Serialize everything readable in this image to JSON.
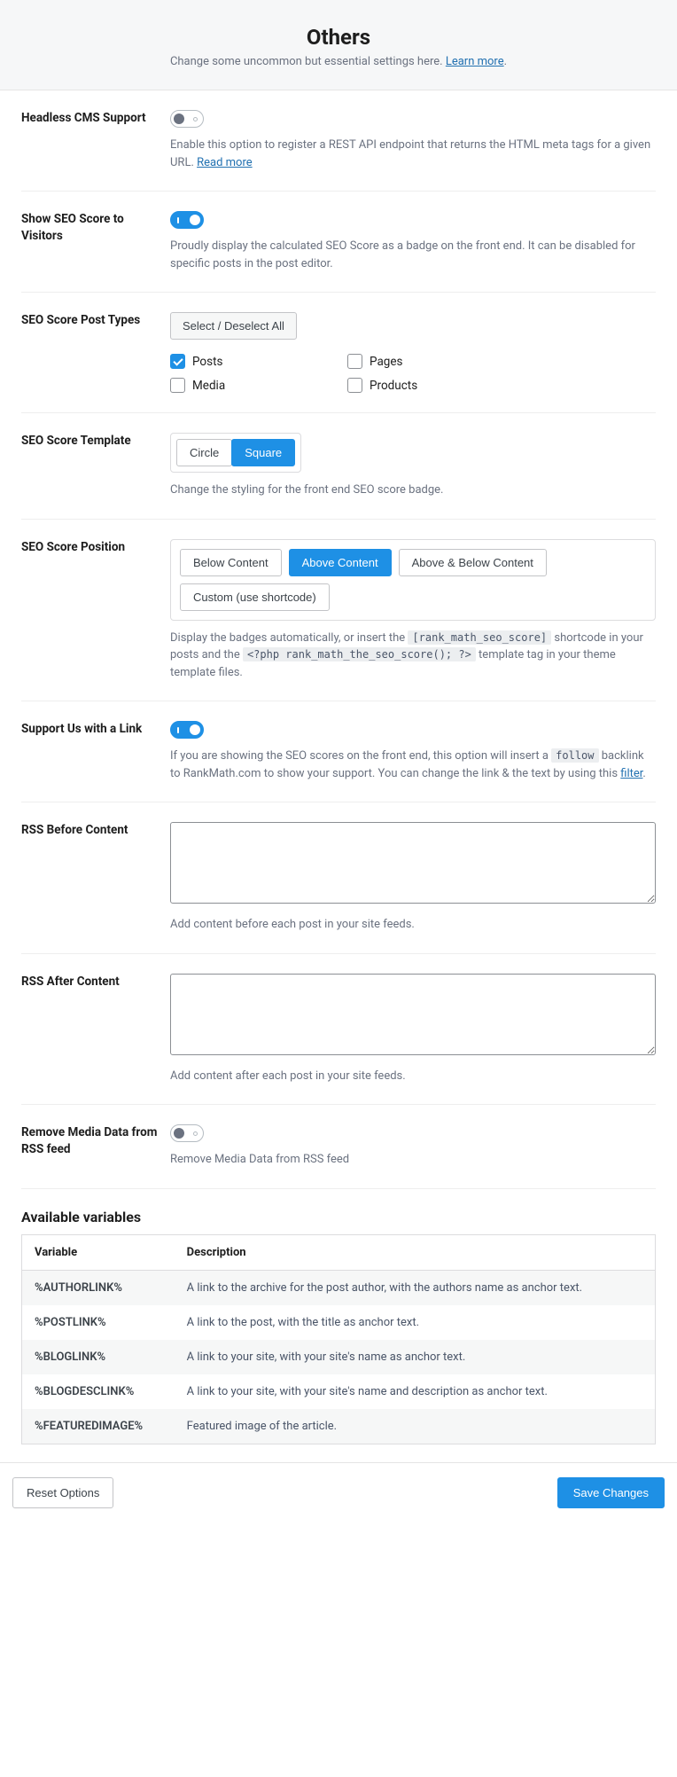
{
  "header": {
    "title": "Others",
    "subtitle_pre": "Change some uncommon but essential settings here. ",
    "learn_more": "Learn more",
    "period": "."
  },
  "rows": {
    "headless": {
      "label": "Headless CMS Support",
      "on": false,
      "desc_pre": "Enable this option to register a REST API endpoint that returns the HTML meta tags for a given URL. ",
      "read_more": "Read more"
    },
    "seo_score_visitors": {
      "label": "Show SEO Score to Visitors",
      "on": true,
      "desc": "Proudly display the calculated SEO Score as a badge on the front end. It can be disabled for specific posts in the post editor."
    },
    "seo_post_types": {
      "label": "SEO Score Post Types",
      "select_all": "Select / Deselect All",
      "items": [
        {
          "label": "Posts",
          "checked": true
        },
        {
          "label": "Pages",
          "checked": false
        },
        {
          "label": "Media",
          "checked": false
        },
        {
          "label": "Products",
          "checked": false
        }
      ]
    },
    "seo_template": {
      "label": "SEO Score Template",
      "options": [
        "Circle",
        "Square"
      ],
      "active": 1,
      "desc": "Change the styling for the front end SEO score badge."
    },
    "seo_position": {
      "label": "SEO Score Position",
      "options": [
        "Below Content",
        "Above Content",
        "Above & Below Content",
        "Custom (use shortcode)"
      ],
      "active": 1,
      "desc_pre": "Display the badges automatically, or insert the ",
      "code1": "[rank_math_seo_score]",
      "desc_mid": " shortcode in your posts and the ",
      "code2": "<?php rank_math_the_seo_score(); ?>",
      "desc_post": " template tag in your theme template files."
    },
    "support_link": {
      "label": "Support Us with a Link",
      "on": true,
      "desc_pre": "If you are showing the SEO scores on the front end, this option will insert a ",
      "code": "follow",
      "desc_mid": " backlink to RankMath.com to show your support. You can change the link & the text by using this ",
      "link": "filter",
      "period": "."
    },
    "rss_before": {
      "label": "RSS Before Content",
      "value": "",
      "desc": "Add content before each post in your site feeds."
    },
    "rss_after": {
      "label": "RSS After Content",
      "value": "",
      "desc": "Add content after each post in your site feeds."
    },
    "remove_media": {
      "label": "Remove Media Data from RSS feed",
      "on": false,
      "desc": "Remove Media Data from RSS feed"
    }
  },
  "variables": {
    "heading": "Available variables",
    "col_var": "Variable",
    "col_desc": "Description",
    "rows": [
      {
        "var": "%AUTHORLINK%",
        "desc": "A link to the archive for the post author, with the authors name as anchor text."
      },
      {
        "var": "%POSTLINK%",
        "desc": "A link to the post, with the title as anchor text."
      },
      {
        "var": "%BLOGLINK%",
        "desc": "A link to your site, with your site's name as anchor text."
      },
      {
        "var": "%BLOGDESCLINK%",
        "desc": "A link to your site, with your site's name and description as anchor text."
      },
      {
        "var": "%FEATUREDIMAGE%",
        "desc": "Featured image of the article."
      }
    ]
  },
  "footer": {
    "reset": "Reset Options",
    "save": "Save Changes"
  }
}
